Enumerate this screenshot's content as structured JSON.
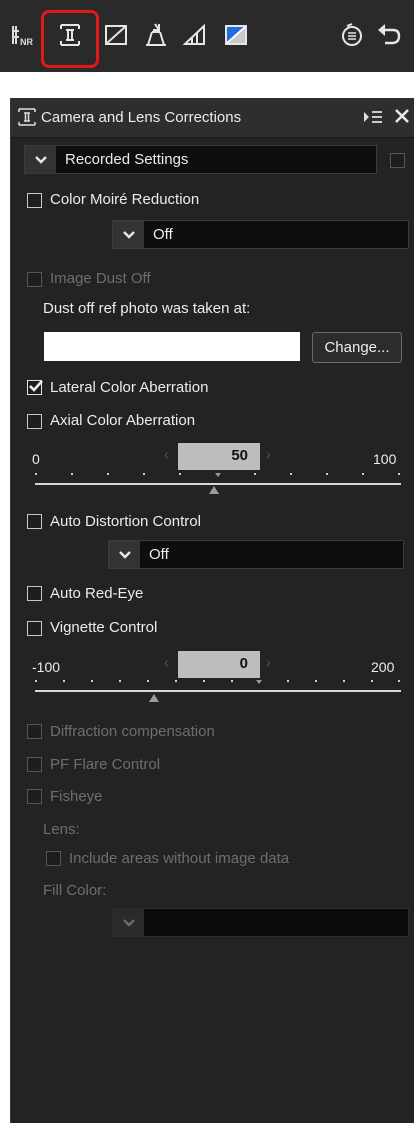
{
  "toolbar": {
    "tools": [
      {
        "icon": "retouch-brush-icon"
      },
      {
        "icon": "camera-lens-corrections-icon",
        "selected": true
      },
      {
        "icon": "straighten-icon"
      },
      {
        "icon": "perspective-control-icon"
      },
      {
        "icon": "crop-icon"
      },
      {
        "icon": "color-adjust-icon"
      },
      {
        "icon": "history-icon"
      },
      {
        "icon": "undo-icon"
      }
    ],
    "highlight_color": "#e01818"
  },
  "panel": {
    "title": "Camera and Lens Corrections",
    "recorded_settings": {
      "value": "Recorded Settings",
      "enabled": false
    },
    "color_moire": {
      "label": "Color Moiré Reduction",
      "checked": false,
      "value": "Off"
    },
    "image_dust": {
      "label": "Image Dust Off",
      "checked": false,
      "disabled": true,
      "ref_label": "Dust off ref photo was taken at:",
      "change_button": "Change..."
    },
    "lateral": {
      "label": "Lateral Color Aberration",
      "checked": true
    },
    "axial": {
      "label": "Axial Color Aberration",
      "checked": false,
      "min": "0",
      "max": "100",
      "value": "50"
    },
    "auto_distortion": {
      "label": "Auto Distortion Control",
      "checked": false,
      "value": "Off"
    },
    "auto_red_eye": {
      "label": "Auto Red-Eye",
      "checked": false
    },
    "vignette": {
      "label": "Vignette Control",
      "checked": false,
      "min": "-100",
      "max": "200",
      "value": "0"
    },
    "diffraction": {
      "label": "Diffraction compensation",
      "checked": false,
      "disabled": true
    },
    "pf_flare": {
      "label": "PF Flare Control",
      "checked": false,
      "disabled": true
    },
    "fisheye": {
      "label": "Fisheye",
      "checked": false,
      "disabled": true,
      "lens_label": "Lens:",
      "include_label": "Include areas without image data",
      "fill_label": "Fill Color:"
    }
  }
}
